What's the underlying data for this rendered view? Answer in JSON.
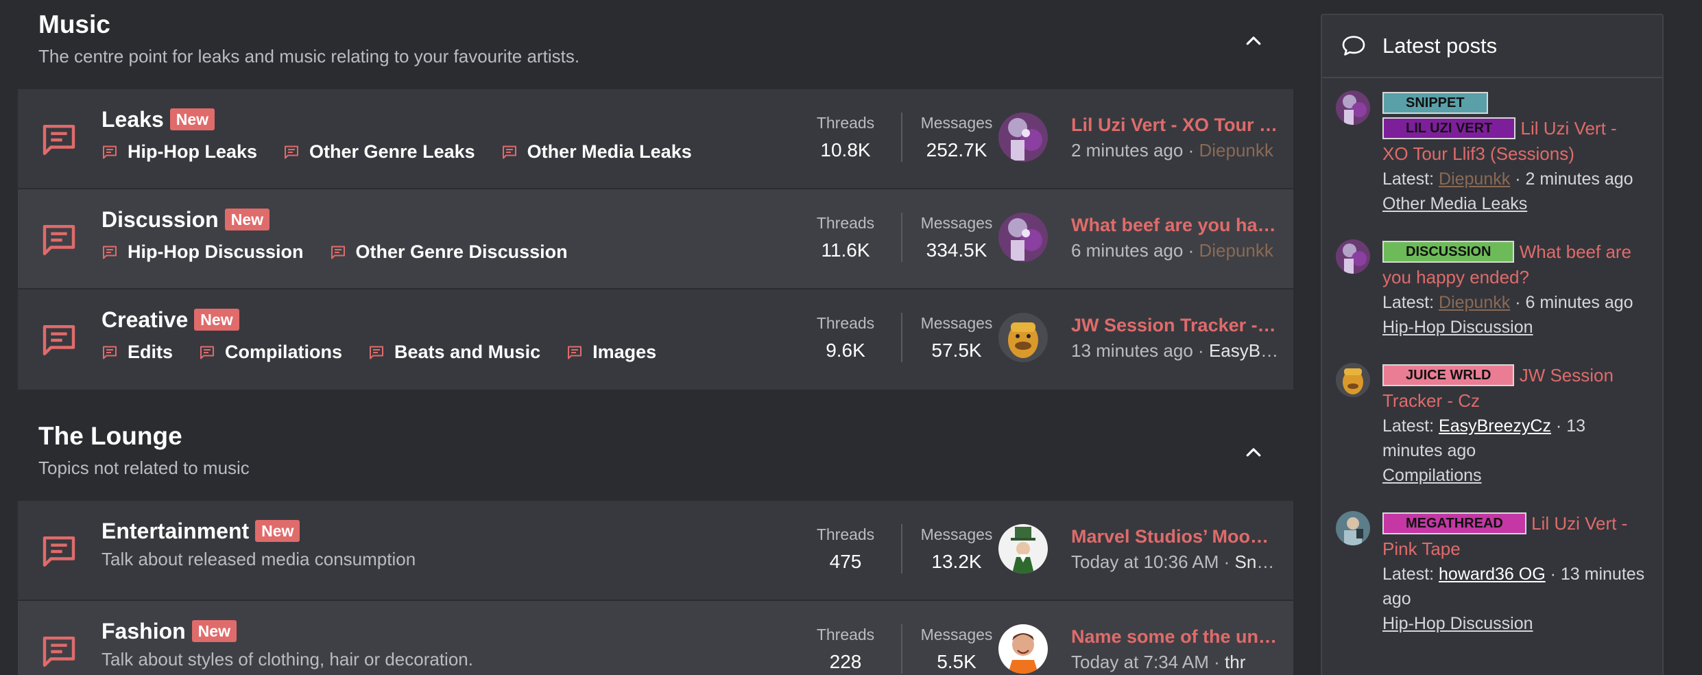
{
  "categories": [
    {
      "title": "Music",
      "description": "The centre point for leaks and music relating to your favourite artists.",
      "nodes": [
        {
          "title": "Leaks",
          "badge": "New",
          "subforums": [
            "Hip-Hop Leaks",
            "Other Genre Leaks",
            "Other Media Leaks"
          ],
          "threads_label": "Threads",
          "threads": "10.8K",
          "messages_label": "Messages",
          "messages": "252.7K",
          "last_title": "Lil Uzi Vert - XO Tour Llif3 (Sessions)",
          "last_time": "2 minutes ago",
          "last_user": "Diepunkk"
        },
        {
          "title": "Discussion",
          "badge": "New",
          "subforums": [
            "Hip-Hop Discussion",
            "Other Genre Discussion"
          ],
          "threads_label": "Threads",
          "threads": "11.6K",
          "messages_label": "Messages",
          "messages": "334.5K",
          "last_title": "What beef are you happy ended?",
          "last_time": "6 minutes ago",
          "last_user": "Diepunkk"
        },
        {
          "title": "Creative",
          "badge": "New",
          "subforums": [
            "Edits",
            "Compilations",
            "Beats and Music",
            "Images"
          ],
          "threads_label": "Threads",
          "threads": "9.6K",
          "messages_label": "Messages",
          "messages": "57.5K",
          "last_title": "JW Session Tracker - Cz",
          "last_time": "13 minutes ago",
          "last_user": "EasyBreezyCz"
        }
      ]
    },
    {
      "title": "The Lounge",
      "description": "Topics not related to music",
      "nodes": [
        {
          "title": "Entertainment",
          "badge": "New",
          "description": "Talk about released media consumption",
          "threads_label": "Threads",
          "threads": "475",
          "messages_label": "Messages",
          "messages": "13.2K",
          "last_title": "Marvel Studios’ Moon Knight",
          "last_time": "Today at 10:36 AM",
          "last_user": "Snoopy"
        },
        {
          "title": "Fashion",
          "badge": "New",
          "description": "Talk about styles of clothing, hair or decoration.",
          "threads_label": "Threads",
          "threads": "228",
          "messages_label": "Messages",
          "messages": "5.5K",
          "last_title": "Name some of the underrated brands",
          "last_time": "Today at 7:34 AM",
          "last_user": "thr"
        }
      ]
    }
  ],
  "sidebar": {
    "title": "Latest posts",
    "latest_prefix": "Latest:",
    "separator": "·",
    "posts": [
      {
        "prefixes": [
          "SNIPPET",
          "LIL UZI VERT"
        ],
        "title": "Lil Uzi Vert - XO Tour Llif3 (Sessions)",
        "user": "Diepunkk",
        "time": "2 minutes ago",
        "forum": "Other Media Leaks"
      },
      {
        "prefixes": [
          "DISCUSSION"
        ],
        "title": "What beef are you happy ended?",
        "user": "Diepunkk",
        "time": "6 minutes ago",
        "forum": "Hip-Hop Discussion"
      },
      {
        "prefixes": [
          "JUICE WRLD"
        ],
        "title": "JW Session Tracker - Cz",
        "user": "EasyBreezyCz",
        "time": "13 minutes ago",
        "forum": "Compilations"
      },
      {
        "prefixes": [
          "MEGATHREAD"
        ],
        "title": "Lil Uzi Vert - Pink Tape",
        "user": "howard36 OG",
        "time": "13 minutes ago",
        "forum": "Hip-Hop Discussion"
      }
    ]
  },
  "colors": {
    "background": "#2b2c30",
    "accent": "#e06b6b",
    "node_bg": "#38393e",
    "node_bg_alt": "#3f4045"
  }
}
